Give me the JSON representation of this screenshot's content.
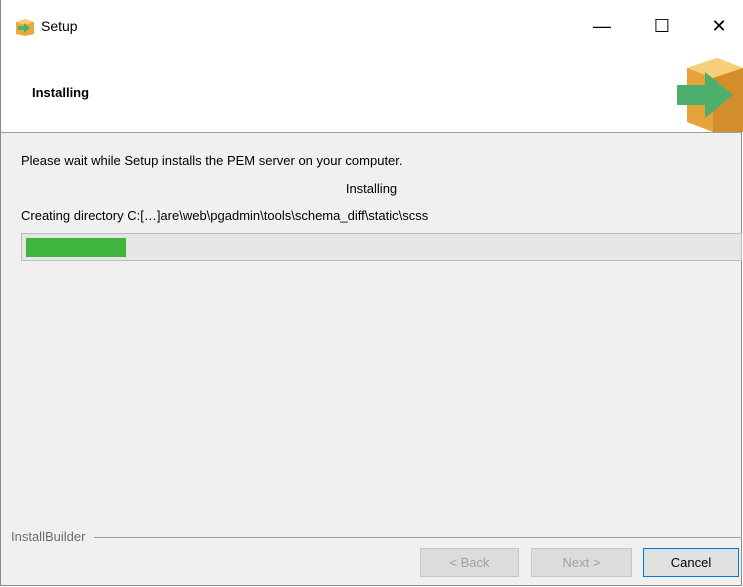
{
  "window": {
    "title": "Setup",
    "minimize_glyph": "—",
    "maximize_glyph": "☐",
    "close_glyph": "✕"
  },
  "header": {
    "title": "Installing",
    "logo_icon": "box-arrow-icon"
  },
  "body": {
    "intro": "Please wait while Setup installs the PEM server on your computer.",
    "status": "Installing",
    "current_file": "Creating directory C:[…]are\\web\\pgadmin\\tools\\schema_diff\\static\\scss",
    "progress_fraction": 0.14
  },
  "footer": {
    "brand": "InstallBuilder",
    "back_label": "< Back",
    "next_label": "Next >",
    "cancel_label": "Cancel"
  },
  "colors": {
    "progress_fill": "#3fb53f",
    "logo_box": "#f2b84b",
    "logo_arrow": "#4caf6e"
  }
}
